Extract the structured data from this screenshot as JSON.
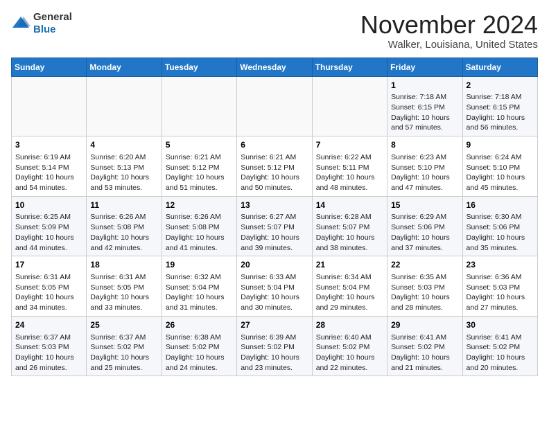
{
  "header": {
    "logo_line1": "General",
    "logo_line2": "Blue",
    "month": "November 2024",
    "location": "Walker, Louisiana, United States"
  },
  "weekdays": [
    "Sunday",
    "Monday",
    "Tuesday",
    "Wednesday",
    "Thursday",
    "Friday",
    "Saturday"
  ],
  "weeks": [
    [
      {
        "day": "",
        "info": ""
      },
      {
        "day": "",
        "info": ""
      },
      {
        "day": "",
        "info": ""
      },
      {
        "day": "",
        "info": ""
      },
      {
        "day": "",
        "info": ""
      },
      {
        "day": "1",
        "info": "Sunrise: 7:18 AM\nSunset: 6:15 PM\nDaylight: 10 hours and 57 minutes."
      },
      {
        "day": "2",
        "info": "Sunrise: 7:18 AM\nSunset: 6:15 PM\nDaylight: 10 hours and 56 minutes."
      }
    ],
    [
      {
        "day": "3",
        "info": "Sunrise: 6:19 AM\nSunset: 5:14 PM\nDaylight: 10 hours and 54 minutes."
      },
      {
        "day": "4",
        "info": "Sunrise: 6:20 AM\nSunset: 5:13 PM\nDaylight: 10 hours and 53 minutes."
      },
      {
        "day": "5",
        "info": "Sunrise: 6:21 AM\nSunset: 5:12 PM\nDaylight: 10 hours and 51 minutes."
      },
      {
        "day": "6",
        "info": "Sunrise: 6:21 AM\nSunset: 5:12 PM\nDaylight: 10 hours and 50 minutes."
      },
      {
        "day": "7",
        "info": "Sunrise: 6:22 AM\nSunset: 5:11 PM\nDaylight: 10 hours and 48 minutes."
      },
      {
        "day": "8",
        "info": "Sunrise: 6:23 AM\nSunset: 5:10 PM\nDaylight: 10 hours and 47 minutes."
      },
      {
        "day": "9",
        "info": "Sunrise: 6:24 AM\nSunset: 5:10 PM\nDaylight: 10 hours and 45 minutes."
      }
    ],
    [
      {
        "day": "10",
        "info": "Sunrise: 6:25 AM\nSunset: 5:09 PM\nDaylight: 10 hours and 44 minutes."
      },
      {
        "day": "11",
        "info": "Sunrise: 6:26 AM\nSunset: 5:08 PM\nDaylight: 10 hours and 42 minutes."
      },
      {
        "day": "12",
        "info": "Sunrise: 6:26 AM\nSunset: 5:08 PM\nDaylight: 10 hours and 41 minutes."
      },
      {
        "day": "13",
        "info": "Sunrise: 6:27 AM\nSunset: 5:07 PM\nDaylight: 10 hours and 39 minutes."
      },
      {
        "day": "14",
        "info": "Sunrise: 6:28 AM\nSunset: 5:07 PM\nDaylight: 10 hours and 38 minutes."
      },
      {
        "day": "15",
        "info": "Sunrise: 6:29 AM\nSunset: 5:06 PM\nDaylight: 10 hours and 37 minutes."
      },
      {
        "day": "16",
        "info": "Sunrise: 6:30 AM\nSunset: 5:06 PM\nDaylight: 10 hours and 35 minutes."
      }
    ],
    [
      {
        "day": "17",
        "info": "Sunrise: 6:31 AM\nSunset: 5:05 PM\nDaylight: 10 hours and 34 minutes."
      },
      {
        "day": "18",
        "info": "Sunrise: 6:31 AM\nSunset: 5:05 PM\nDaylight: 10 hours and 33 minutes."
      },
      {
        "day": "19",
        "info": "Sunrise: 6:32 AM\nSunset: 5:04 PM\nDaylight: 10 hours and 31 minutes."
      },
      {
        "day": "20",
        "info": "Sunrise: 6:33 AM\nSunset: 5:04 PM\nDaylight: 10 hours and 30 minutes."
      },
      {
        "day": "21",
        "info": "Sunrise: 6:34 AM\nSunset: 5:04 PM\nDaylight: 10 hours and 29 minutes."
      },
      {
        "day": "22",
        "info": "Sunrise: 6:35 AM\nSunset: 5:03 PM\nDaylight: 10 hours and 28 minutes."
      },
      {
        "day": "23",
        "info": "Sunrise: 6:36 AM\nSunset: 5:03 PM\nDaylight: 10 hours and 27 minutes."
      }
    ],
    [
      {
        "day": "24",
        "info": "Sunrise: 6:37 AM\nSunset: 5:03 PM\nDaylight: 10 hours and 26 minutes."
      },
      {
        "day": "25",
        "info": "Sunrise: 6:37 AM\nSunset: 5:02 PM\nDaylight: 10 hours and 25 minutes."
      },
      {
        "day": "26",
        "info": "Sunrise: 6:38 AM\nSunset: 5:02 PM\nDaylight: 10 hours and 24 minutes."
      },
      {
        "day": "27",
        "info": "Sunrise: 6:39 AM\nSunset: 5:02 PM\nDaylight: 10 hours and 23 minutes."
      },
      {
        "day": "28",
        "info": "Sunrise: 6:40 AM\nSunset: 5:02 PM\nDaylight: 10 hours and 22 minutes."
      },
      {
        "day": "29",
        "info": "Sunrise: 6:41 AM\nSunset: 5:02 PM\nDaylight: 10 hours and 21 minutes."
      },
      {
        "day": "30",
        "info": "Sunrise: 6:41 AM\nSunset: 5:02 PM\nDaylight: 10 hours and 20 minutes."
      }
    ]
  ]
}
